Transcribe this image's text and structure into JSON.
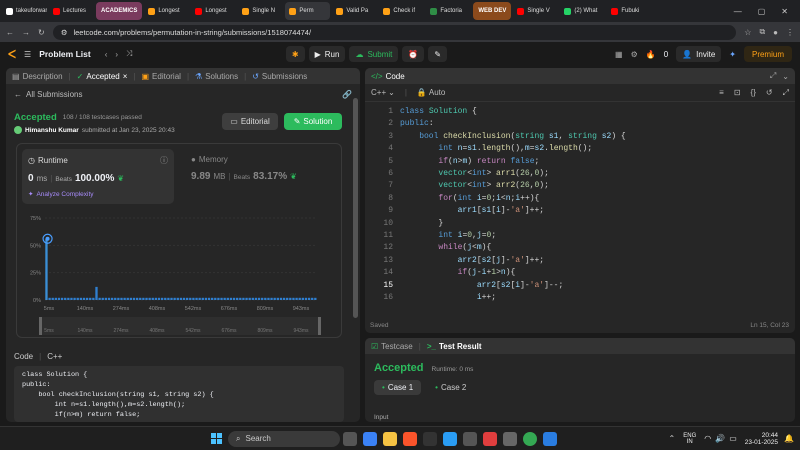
{
  "browser": {
    "tabs": [
      {
        "label": "takeuforward",
        "color": "#ffffff"
      },
      {
        "label": "Lectures",
        "color": "#ff0000"
      },
      {
        "label": "ACADEMICS",
        "group": true,
        "color": "#7a3b5e"
      },
      {
        "label": "Longest",
        "color": "#ffa116"
      },
      {
        "label": "Longest",
        "color": "#ff0000"
      },
      {
        "label": "Single N",
        "color": "#ffa116"
      },
      {
        "label": "Perm",
        "color": "#ffa116",
        "active": true
      },
      {
        "label": "Valid Pa",
        "color": "#ffa116"
      },
      {
        "label": "Check if",
        "color": "#ffa116"
      },
      {
        "label": "Factoria",
        "color": "#2f8d46"
      },
      {
        "label": "WEB DEV",
        "group": true,
        "color": "#8b4a1c"
      },
      {
        "label": "Single V",
        "color": "#ff0000"
      },
      {
        "label": "(2) What",
        "color": "#25d366"
      },
      {
        "label": "Fubuki",
        "color": "#ff0000"
      }
    ],
    "url": "leetcode.com/problems/permutation-in-string/submissions/1518074474/"
  },
  "nav": {
    "problem_list": "Problem List",
    "run": "Run",
    "submit": "Submit",
    "streak": "0",
    "invite": "Invite",
    "premium": "Premium"
  },
  "left": {
    "tabs": [
      "Description",
      "Accepted",
      "Editorial",
      "Solutions",
      "Submissions"
    ],
    "all_submissions": "All Submissions",
    "status": "Accepted",
    "testcases": "108 / 108 testcases passed",
    "user": "Himanshu Kumar",
    "submitted": "submitted at Jan 23, 2025 20:43",
    "editorial_btn": "Editorial",
    "solution_btn": "Solution",
    "runtime_label": "Runtime",
    "runtime_value": "0",
    "runtime_unit": "ms",
    "beats_label": "Beats",
    "runtime_beats": "100.00%",
    "analyze": "Analyze Complexity",
    "memory_label": "Memory",
    "memory_value": "9.89",
    "memory_unit": "MB",
    "memory_beats": "83.17%",
    "code_label": "Code",
    "code_lang": "C++",
    "code_preview": [
      "class Solution {",
      "public:",
      "    bool checkInclusion(string s1, string s2) {",
      "        int n=s1.length(),m=s2.length();",
      "        if(n>m) return false;"
    ]
  },
  "chart_data": {
    "type": "bar",
    "y_ticks": [
      "75%",
      "50%",
      "25%",
      "0%"
    ],
    "x_ticks": [
      "5ms",
      "140ms",
      "274ms",
      "408ms",
      "542ms",
      "676ms",
      "809ms",
      "943ms"
    ],
    "mini_ticks": [
      "5ms",
      "140ms",
      "274ms",
      "408ms",
      "542ms",
      "676ms",
      "809ms",
      "943ms"
    ],
    "ylim": [
      0,
      75
    ],
    "bars": [
      56,
      2,
      2,
      2,
      2,
      2,
      2,
      2,
      2,
      2,
      2,
      2,
      2,
      2,
      2,
      2,
      12,
      2,
      2,
      2,
      2,
      2,
      2,
      2,
      2,
      2,
      2,
      2,
      2,
      2,
      2,
      2,
      2,
      2,
      2,
      2,
      2,
      2,
      2,
      2,
      2,
      2,
      2,
      2,
      2,
      2,
      2,
      2,
      2,
      2,
      2,
      2,
      2,
      2,
      2,
      2,
      2,
      2,
      2,
      2,
      2,
      2,
      2,
      2,
      2,
      2,
      2,
      2,
      2,
      2,
      2,
      2,
      2,
      2,
      2,
      2,
      2,
      2,
      2,
      2,
      2,
      2,
      2,
      2,
      2,
      2,
      2
    ]
  },
  "editor": {
    "title": "Code",
    "lang": "C++",
    "mode": "Auto",
    "saved": "Saved",
    "cursor": "Ln 15, Col 23",
    "line_numbers": [
      "1",
      "2",
      "3",
      "4",
      "5",
      "6",
      "7",
      "8",
      "9",
      "10",
      "11",
      "12",
      "13",
      "14",
      "15",
      "16"
    ]
  },
  "result": {
    "testcase_tab": "Testcase",
    "result_tab": "Test Result",
    "status": "Accepted",
    "runtime": "Runtime: 0 ms",
    "case1": "Case 1",
    "case2": "Case 2",
    "input_label": "Input"
  },
  "taskbar": {
    "search": "Search",
    "lang": "ENG",
    "region": "IN",
    "time": "20:44",
    "date": "23-01-2025"
  }
}
